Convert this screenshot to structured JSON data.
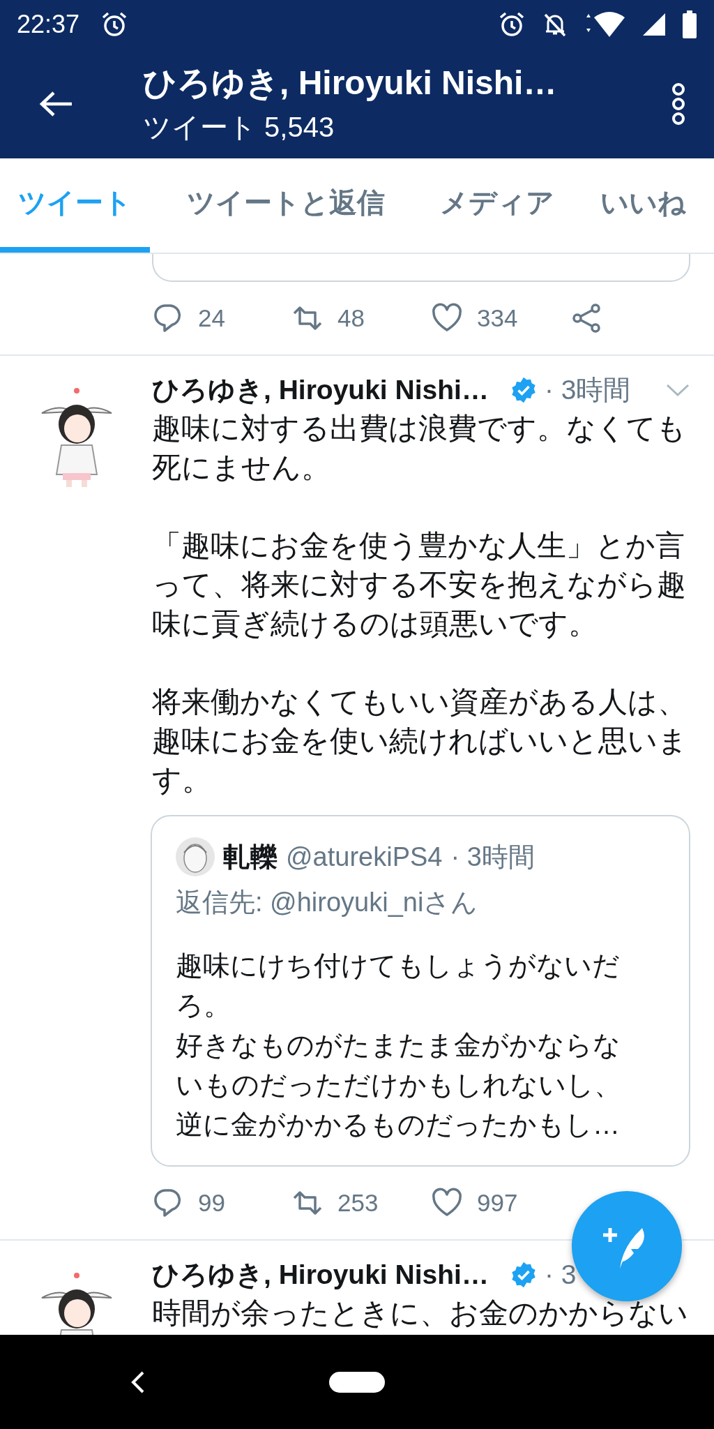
{
  "status_bar": {
    "time": "22:37"
  },
  "header": {
    "title": "ひろゆき, Hiroyuki Nishi…",
    "subtitle": "ツイート 5,543"
  },
  "tabs": [
    {
      "label": "ツイート",
      "selected": true
    },
    {
      "label": "ツイートと返信",
      "selected": false
    },
    {
      "label": "メディア",
      "selected": false
    },
    {
      "label": "いいね",
      "selected": false
    }
  ],
  "tweets": [
    {
      "kind": "tail",
      "actions": {
        "replies": "24",
        "retweets": "48",
        "likes": "334"
      }
    },
    {
      "kind": "full",
      "name": "ひろゆき, Hiroyuki Nishi…",
      "verified": true,
      "time": "· 3時間",
      "body": [
        "趣味に対する出費は浪費です。なくても死にません。",
        "「趣味にお金を使う豊かな人生」とか言って、将来に対する不安を抱えながら趣味に貢ぎ続けるのは頭悪いです。",
        "将来働かなくてもいい資産がある人は、趣味にお金を使い続ければいいと思います。"
      ],
      "quote": {
        "name": "軋轢",
        "handle": "@aturekiPS4",
        "time": "· 3時間",
        "reply_to": "返信先: @hiroyuki_niさん",
        "body": [
          "趣味にけち付けてもしょうがないだろ。",
          "好きなものがたまたま金がかならないものだっただけかもしれないし、",
          "逆に金がかかるものだったかもし…"
        ]
      },
      "actions": {
        "replies": "99",
        "retweets": "253",
        "likes": "997"
      }
    },
    {
      "kind": "cut",
      "name": "ひろゆき, Hiroyuki Nishi…",
      "verified": true,
      "time": "· 3",
      "body": [
        "時間が余ったときに、お金のかからない"
      ]
    }
  ]
}
